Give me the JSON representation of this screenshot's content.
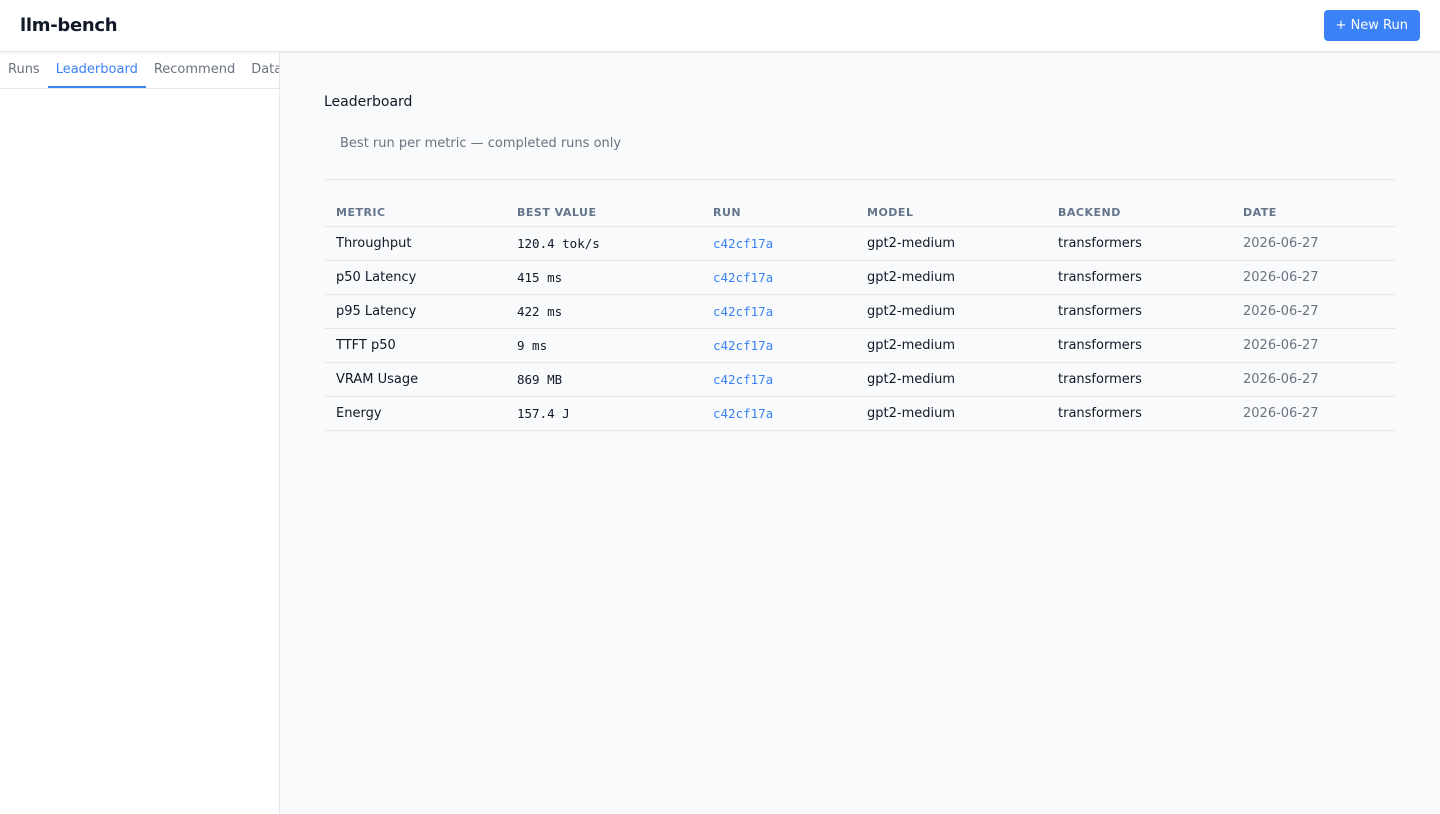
{
  "app": {
    "title": "llm-bench"
  },
  "header": {
    "new_run_label": "+ New Run"
  },
  "sidebar": {
    "tabs": [
      {
        "label": "Runs",
        "active": false
      },
      {
        "label": "Leaderboard",
        "active": true
      },
      {
        "label": "Recommend",
        "active": false
      },
      {
        "label": "Datase",
        "active": false
      }
    ]
  },
  "main": {
    "title": "Leaderboard",
    "subtitle": "Best run per metric — completed runs only",
    "table": {
      "columns": [
        "METRIC",
        "BEST VALUE",
        "RUN",
        "MODEL",
        "BACKEND",
        "DATE"
      ],
      "rows": [
        {
          "metric": "Throughput",
          "best_value": "120.4 tok/s",
          "run": "c42cf17a",
          "model": "gpt2-medium",
          "backend": "transformers",
          "date": "2026-06-27"
        },
        {
          "metric": "p50 Latency",
          "best_value": "415 ms",
          "run": "c42cf17a",
          "model": "gpt2-medium",
          "backend": "transformers",
          "date": "2026-06-27"
        },
        {
          "metric": "p95 Latency",
          "best_value": "422 ms",
          "run": "c42cf17a",
          "model": "gpt2-medium",
          "backend": "transformers",
          "date": "2026-06-27"
        },
        {
          "metric": "TTFT p50",
          "best_value": "9 ms",
          "run": "c42cf17a",
          "model": "gpt2-medium",
          "backend": "transformers",
          "date": "2026-06-27"
        },
        {
          "metric": "VRAM Usage",
          "best_value": "869 MB",
          "run": "c42cf17a",
          "model": "gpt2-medium",
          "backend": "transformers",
          "date": "2026-06-27"
        },
        {
          "metric": "Energy",
          "best_value": "157.4 J",
          "run": "c42cf17a",
          "model": "gpt2-medium",
          "backend": "transformers",
          "date": "2026-06-27"
        }
      ]
    }
  },
  "colors": {
    "accent": "#3b82f6",
    "text": "#111827",
    "muted": "#6b7280",
    "border": "#e5e7eb",
    "background": "#f8fafc"
  }
}
